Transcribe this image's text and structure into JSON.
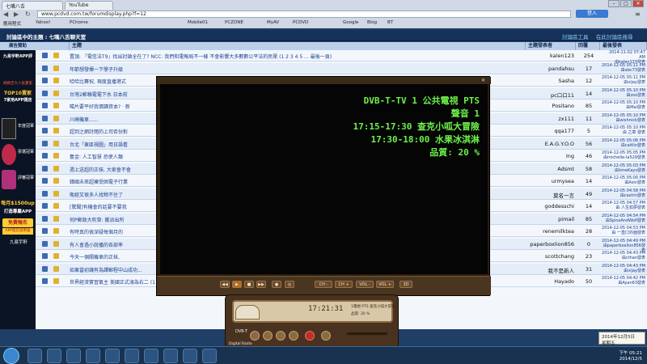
{
  "browser": {
    "tabs": [
      "七嘴八舌",
      "YouTube"
    ],
    "url": "www.pcdvd.com.tw/forumdisplay.php?f=12",
    "bookmarks": [
      "應用程式",
      "Yahoo!",
      "PChome",
      "Mobile01",
      "PCZONE",
      "MyAV",
      "PCDVD",
      "Google",
      "Blog",
      "BT"
    ],
    "signin": "登入"
  },
  "forum": {
    "breadcrumb": "討論區中的主題 : 七嘴八舌聊天室",
    "right_links": [
      "討論區工具",
      "在此討論區搜尋"
    ],
    "columns": [
      "主題",
      "主題發表者",
      "回覆",
      "最後發表"
    ],
    "sidebar_title": "廣告贊助"
  },
  "rows": [
    {
      "title": "置頂: 「電信法T9」找出討論全在了? NCC: 我們和電報局不一樣 不會影響大多數數公平法的民眾 (1 2 3 4 5 ... 最後一頁)",
      "author": "kalen123",
      "replies": "254",
      "time": "2014-11-02 07:47 AM",
      "by": "由kalen123發表"
    },
    {
      "title": "年節想發揮一下學子升級",
      "author": "pandahsu",
      "replies": "17",
      "time": "2014-12-05 05:11 PM",
      "by": "由abc73發表"
    },
    {
      "title": "哈哈比賽祝, 現度直播港式",
      "author": "Sasha",
      "replies": "12",
      "time": "2014-12-05 05:11 PM",
      "by": "由vijay發表"
    },
    {
      "title": "台灣2郵稿電電下水 日本前",
      "author": "pc口口11",
      "replies": "14",
      "time": "2014-12-05 05:10 PM",
      "by": "由zox發表"
    },
    {
      "title": "噶片要平好我價讀資本? · 新",
      "author": "Positano",
      "replies": "85",
      "time": "2014-12-05 05:10 PM",
      "by": "由Mal發表"
    },
    {
      "title": "川崎機車......",
      "author": "zx111",
      "replies": "11",
      "time": "2014-12-05 05:10 PM",
      "by": "由wishnick發表"
    },
    {
      "title": "超到之網討閱的上司否份對",
      "author": "qqa177",
      "replies": "5",
      "time": "2014-12-05 05:10 PM",
      "by": "由 之章 發表"
    },
    {
      "title": "台北「東區視圖」用日語看",
      "author": "E.A.G.Y.O.O",
      "replies": "56",
      "time": "2014-12-05 05:06 PM",
      "by": "由caitlin發表"
    },
    {
      "title": "奮金: 人工智慧 恐使人類",
      "author": "Ing",
      "replies": "46",
      "time": "2014-12-05 05:05 PM",
      "by": "由michelle-la529發表"
    },
    {
      "title": "週上送超的正抹, 大家會不會",
      "author": "Adsmt",
      "replies": "58",
      "time": "2014-12-05 05:03 PM",
      "by": "由timeKays發表"
    },
    {
      "title": "韓國未來超擁受困電子行業",
      "author": "urmysea",
      "replies": "14",
      "time": "2014-12-05 05:00 PM",
      "by": "由Asin發表"
    },
    {
      "title": "衛經又很多人找物不住了",
      "author": "莫名一言",
      "replies": "49",
      "time": "2014-12-05 04:58 PM",
      "by": "由cashin發表"
    },
    {
      "title": "[驚聞]有機會的話要不要我",
      "author": "goddesschi",
      "replies": "14",
      "time": "2014-12-05 04:57 PM",
      "by": "由 人生如夢發表"
    },
    {
      "title": "何P郵政大吹草: 搬派出所",
      "author": "pimail",
      "replies": "85",
      "time": "2014-12-05 04:54 PM",
      "by": "由SpiceAndWolf發表"
    },
    {
      "title": "有時真的很深疑每個月的",
      "author": "renemilktea",
      "replies": "28",
      "time": "2014-12-05 04:53 PM",
      "by": "由 一直口外面發表"
    },
    {
      "title": "有人會過小說播的各部率",
      "author": "paperboxlion856",
      "replies": "0",
      "time": "2014-12-05 04:49 PM",
      "by": "由paperboxlion856發表"
    },
    {
      "title": "今天一個關機車的正抹,",
      "author": "scottchang",
      "replies": "23",
      "time": "2014-12-05 04:43 PM",
      "by": "由cthan發表"
    },
    {
      "title": "如果當初讓有為譯郵程中山成功...",
      "author": "我不是新人",
      "replies": "31",
      "time": "2014-12-05 04:43 PM",
      "by": "由vijay發表"
    },
    {
      "title": "世界經濟實習氣主 美國正式淪為右二 (1 2)",
      "author": "Hayado",
      "replies": "50",
      "time": "2014-12-05 04:42 PM",
      "by": "由Ayan63發表"
    }
  ],
  "ads": {
    "line1": "九易宇軒APP評",
    "line2": "網路百大人氣賣家",
    "line3": "TOP10賣家",
    "line4": "7家用APP開店",
    "award1": "年度冠軍",
    "award2": "票選冠軍",
    "award3": "評審冠軍",
    "price": "每月$1500up",
    "price2": "打造專屬APP",
    "cta": "免費報名",
    "cta2": "APP開店說明會",
    "brand": "九易宇軒"
  },
  "player": {
    "lines": [
      "DVB-T-TV 1 公共電視 PTS",
      "聲音 1",
      "17:15-17:30 查克小呱大冒險",
      "17:30-18:00 水果冰淇淋",
      "品質: 20 %"
    ],
    "controls": [
      "CH -",
      "CH +",
      "VOL -",
      "VOL +",
      "3D"
    ],
    "mini_clock": "17:21:31",
    "mini_text": "1電視 PTS 查克小呱大冒險",
    "mini_quality": "品質: 20 %",
    "mini_label": "DVB-T",
    "mini_label2": "Digital Radio"
  },
  "taskbar": {
    "time": "下午 05:21",
    "date": "2014/12/5",
    "tooltip1": "2014年12月5日",
    "tooltip2": "星期五"
  }
}
